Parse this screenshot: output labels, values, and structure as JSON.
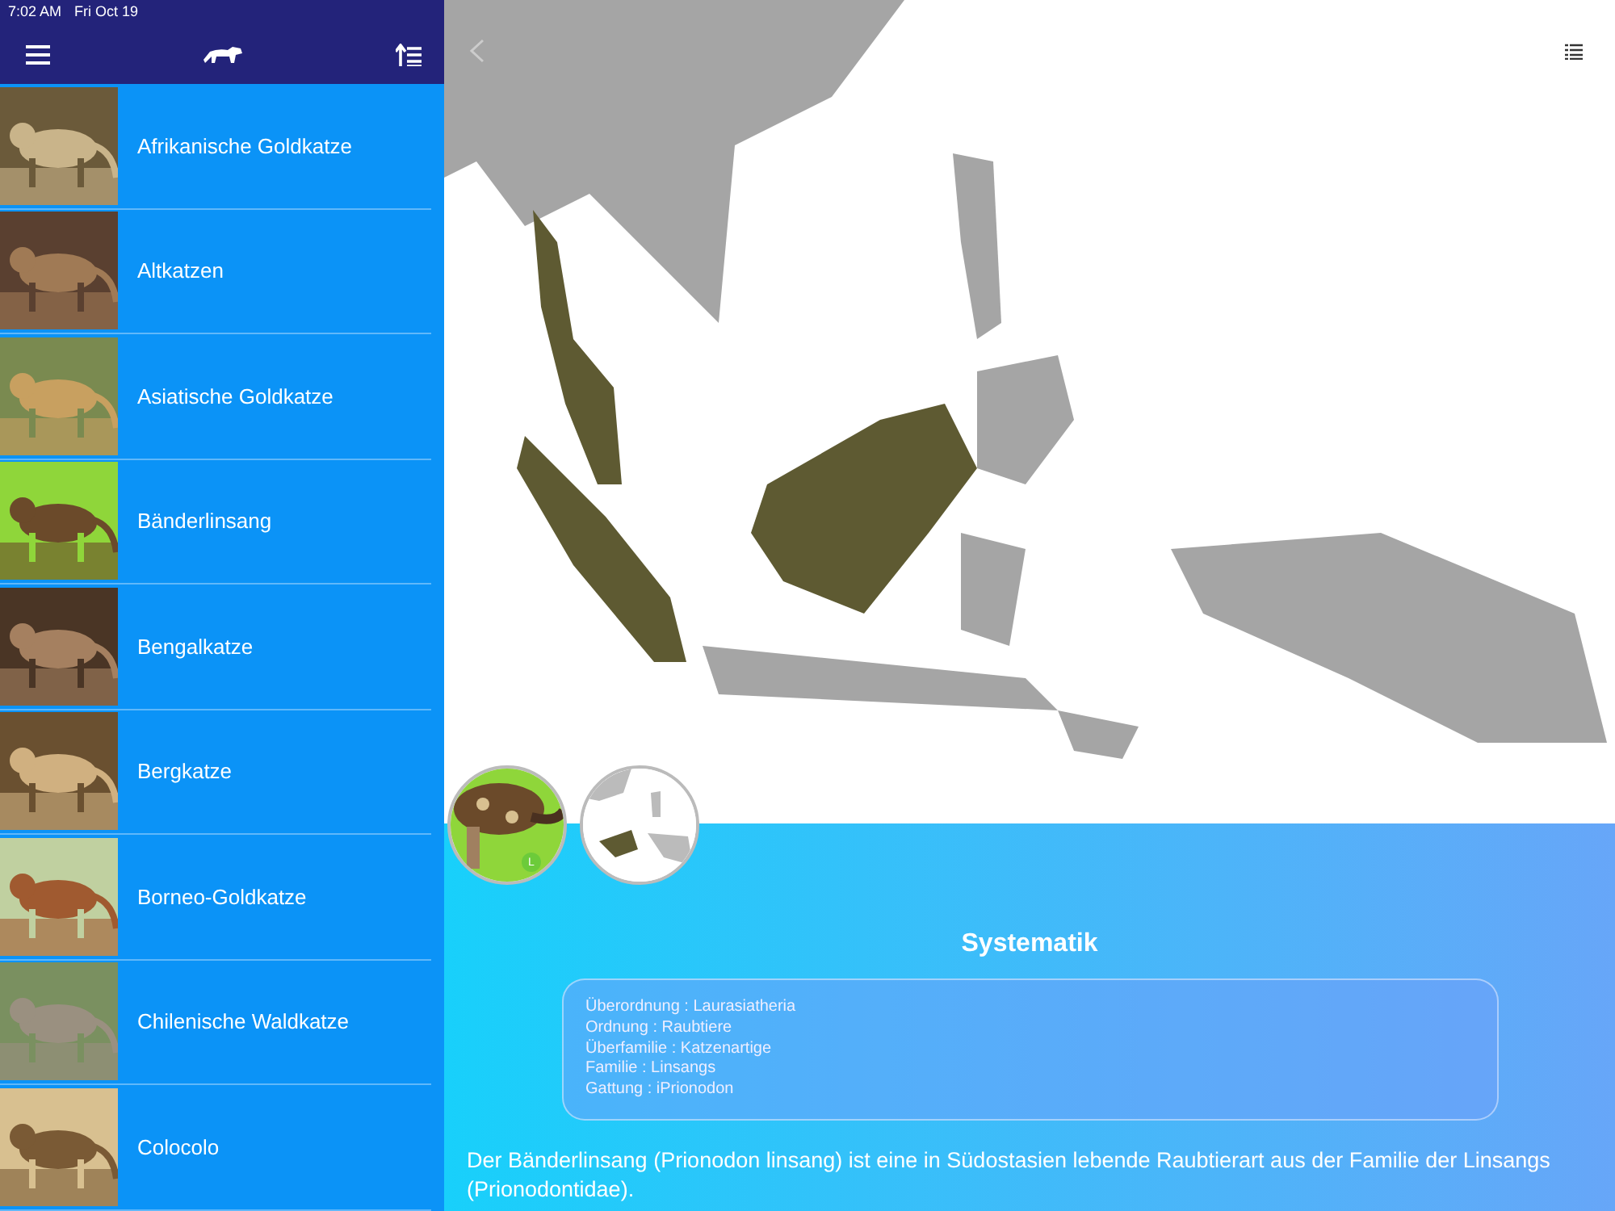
{
  "status_bar": {
    "time": "7:02 AM",
    "date": "Fri Oct 19"
  },
  "sidebar": {
    "items": [
      {
        "name": "Afrikanische Goldkatze",
        "kind": "picture"
      },
      {
        "name": "Altkatzen",
        "kind": "picture"
      },
      {
        "name": "Asiatische Goldkatze",
        "kind": "picture"
      },
      {
        "name": "Bänderlinsang",
        "kind": "picture"
      },
      {
        "name": "Bengalkatze",
        "kind": "picture"
      },
      {
        "name": "Bergkatze",
        "kind": "picture"
      },
      {
        "name": "Borneo-Goldkatze",
        "kind": "picture"
      },
      {
        "name": "Chilenische Waldkatze",
        "kind": "picture"
      },
      {
        "name": "Colocolo",
        "kind": "picture"
      }
    ]
  },
  "detail": {
    "photo_badge": "L",
    "section_title": "Systematik",
    "taxonomy": [
      "Überordnung : Laurasiatheria",
      "Ordnung : Raubtiere",
      "Überfamilie : Katzenartige",
      "Familie : Linsangs",
      "Gattung : iPrionodon"
    ],
    "description": "Der Bänderlinsang (Prionodon linsang) ist eine in Südostasien lebende Raubtierart aus der Familie der Linsangs (Prionodontidae)."
  }
}
